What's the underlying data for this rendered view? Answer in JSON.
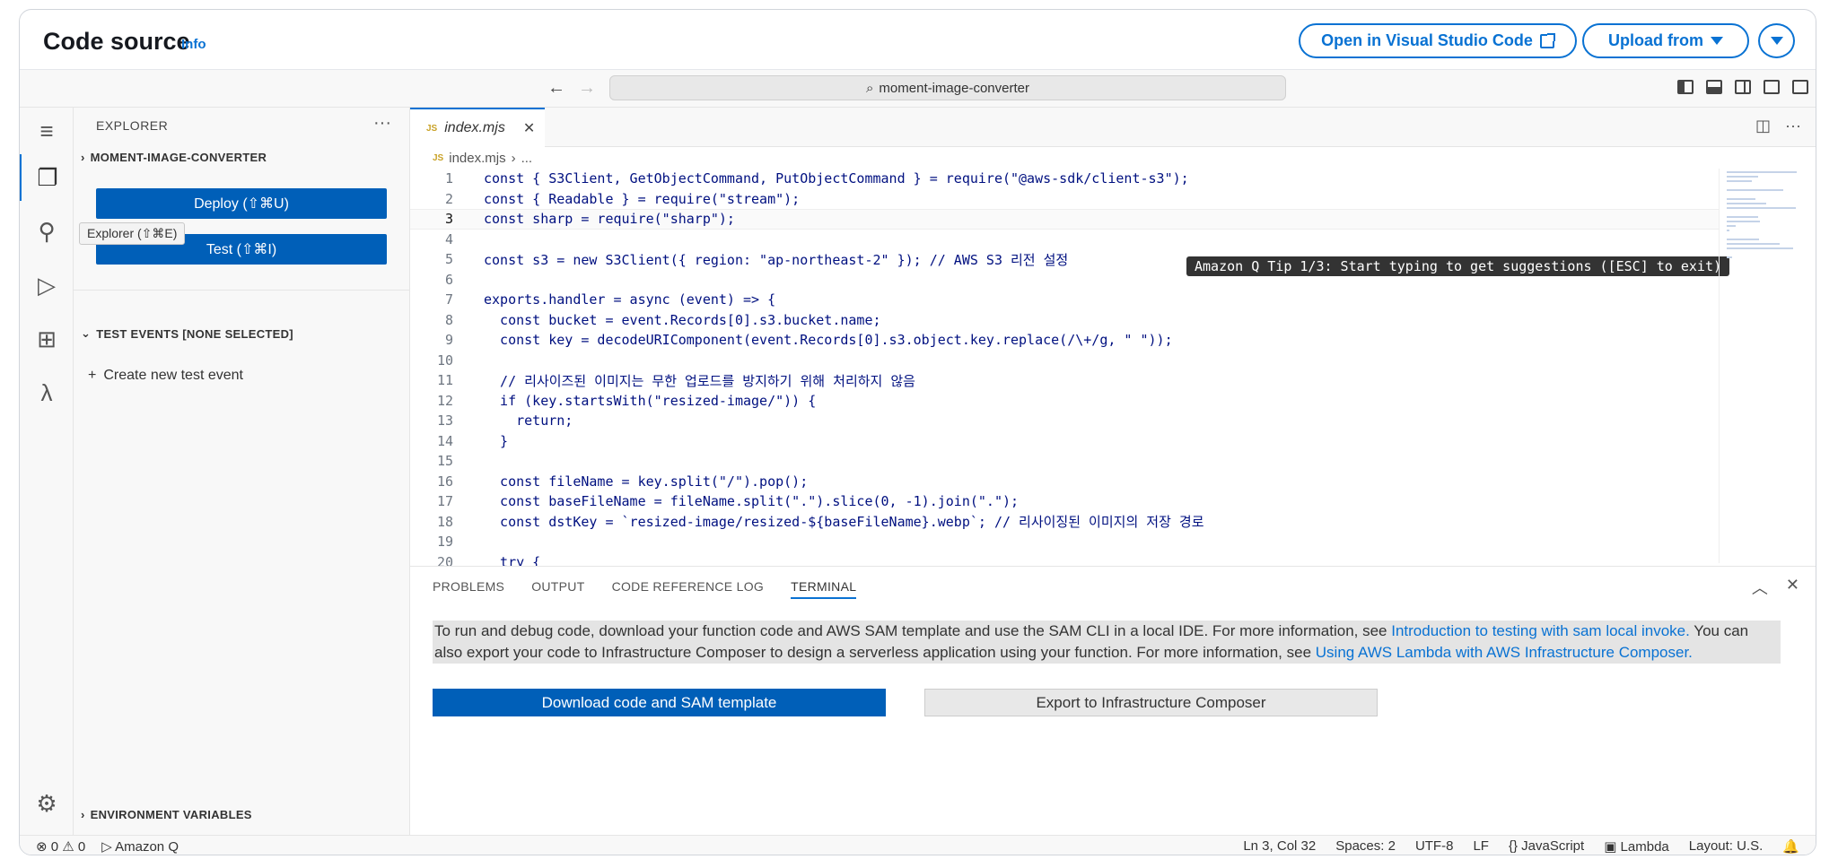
{
  "header": {
    "title": "Code source",
    "info": "Info",
    "open_vscode": "Open in Visual Studio Code",
    "upload_from": "Upload from"
  },
  "titlebar": {
    "search": "moment-image-converter"
  },
  "activity": {
    "tooltip": "Explorer (⇧⌘E)"
  },
  "sidebar": {
    "heading": "EXPLORER",
    "project": "MOMENT-IMAGE-CONVERTER",
    "deploy_label": "Deploy (⇧⌘U)",
    "test_label": "Test (⇧⌘I)",
    "test_events": "TEST EVENTS [NONE SELECTED]",
    "create_event": "Create new test event",
    "env_vars": "ENVIRONMENT VARIABLES"
  },
  "editor": {
    "tab": "index.mjs",
    "tab_badge": "JS",
    "breadcrumb_file": "index.mjs",
    "breadcrumb_more": "...",
    "cursor_line": 3,
    "q_tip": "Amazon Q Tip 1/3: Start typing to get suggestions ([ESC] to exit)",
    "lines": [
      "const { S3Client, GetObjectCommand, PutObjectCommand } = require(\"@aws-sdk/client-s3\");",
      "const { Readable } = require(\"stream\");",
      "const sharp = require(\"sharp\");",
      "",
      "const s3 = new S3Client({ region: \"ap-northeast-2\" }); // AWS S3 리전 설정",
      "",
      "exports.handler = async (event) => {",
      "  const bucket = event.Records[0].s3.bucket.name;",
      "  const key = decodeURIComponent(event.Records[0].s3.object.key.replace(/\\+/g, \" \"));",
      "",
      "  // 리사이즈된 이미지는 무한 업로드를 방지하기 위해 처리하지 않음",
      "  if (key.startsWith(\"resized-image/\")) {",
      "    return;",
      "  }",
      "",
      "  const fileName = key.split(\"/\").pop();",
      "  const baseFileName = fileName.split(\".\").slice(0, -1).join(\".\");",
      "  const dstKey = `resized-image/resized-${baseFileName}.webp`; // 리사이징된 이미지의 저장 경로",
      "",
      "  try {"
    ]
  },
  "panel": {
    "tabs": [
      "PROBLEMS",
      "OUTPUT",
      "CODE REFERENCE LOG",
      "TERMINAL"
    ],
    "active_tab": "TERMINAL",
    "text_1": "To run and debug code, download your function code and AWS SAM template and use the SAM CLI in a local IDE. For more information, see ",
    "link_1": "Introduction to testing with sam local invoke.",
    "text_2": " You can also export your code to Infrastructure Composer to design a serverless application using your function. For more information, see ",
    "link_2": "Using AWS Lambda with AWS Infrastructure Composer.",
    "download_btn": "Download code and SAM template",
    "export_btn": "Export to Infrastructure Composer"
  },
  "status": {
    "errors": "0",
    "warnings": "0",
    "amazon_q": "Amazon Q",
    "position": "Ln 3, Col 32",
    "spaces": "Spaces: 2",
    "encoding": "UTF-8",
    "eol": "LF",
    "language": "JavaScript",
    "lambda": "Lambda",
    "layout": "Layout: U.S."
  },
  "colors": {
    "accent": "#0972d3",
    "primary_button": "#005fb8"
  }
}
